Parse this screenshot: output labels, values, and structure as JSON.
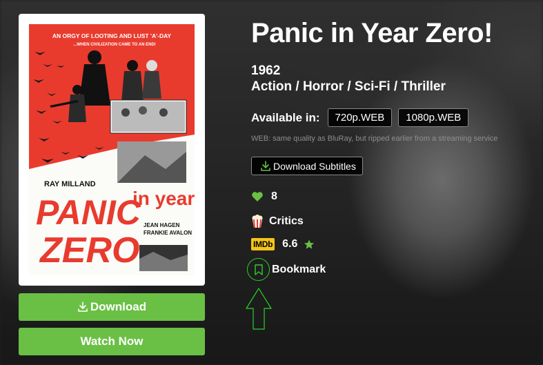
{
  "movie": {
    "title": "Panic in Year Zero!",
    "year": "1962",
    "genres": "Action / Horror / Sci-Fi / Thriller"
  },
  "availability": {
    "label": "Available in:",
    "qualities": [
      "720p.WEB",
      "1080p.WEB"
    ],
    "note": "WEB: same quality as BluRay, but ripped earlier from a streaming service"
  },
  "actions": {
    "download_subtitles": "Download Subtitles",
    "download": "Download",
    "watch_now": "Watch Now",
    "bookmark": "Bookmark"
  },
  "stats": {
    "likes": "8",
    "critics": "Critics",
    "imdb_badge": "IMDb",
    "imdb_rating": "6.6"
  },
  "poster": {
    "tagline": "AN ORGY OF LOOTING AND LUST 'A'-DAY",
    "subtagline": "...WHEN CIVILIZATION CAME TO AN END!",
    "star": "RAY MILLAND",
    "title_line1": "PANIC",
    "title_line2": "in year",
    "title_line3": "ZERO",
    "costar1": "JEAN HAGEN",
    "costar2": "FRANKIE AVALON"
  },
  "colors": {
    "green": "#6ac045",
    "outline_green": "#2ad12a",
    "imdb_yellow": "#f5c518",
    "poster_red": "#e83b2e"
  },
  "icons": {
    "download": "download-icon",
    "heart": "heart-icon",
    "popcorn": "popcorn-icon",
    "star": "star-icon",
    "bookmark": "bookmark-icon",
    "arrow": "up-arrow-icon"
  }
}
